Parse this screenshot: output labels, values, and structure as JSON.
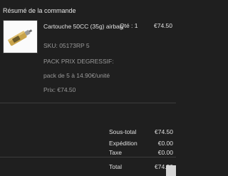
{
  "summary": {
    "title": "Résumé de la commande"
  },
  "item": {
    "name": "Cartouche 50CC (35g) airbag",
    "qty": "Qté : 1",
    "price": "€74.50",
    "sku": "SKU: 05173RP 5",
    "offer": "PACK PRIX DEGRESSIF:",
    "pack": "pack de 5 à 14.90€/unité",
    "unit_price": "Prix: €74.50"
  },
  "totals": {
    "subtotal_label": "Sous-total",
    "subtotal": "€74.50",
    "shipping_label": "Expédition",
    "shipping": "€0.00",
    "tax_label": "Taxe",
    "tax": "€0.00",
    "total_label": "Total",
    "total": "€74.50"
  },
  "colors": {
    "background": "#1f1f1f",
    "text": "#e0e0e0",
    "muted": "#9a9a9a"
  }
}
